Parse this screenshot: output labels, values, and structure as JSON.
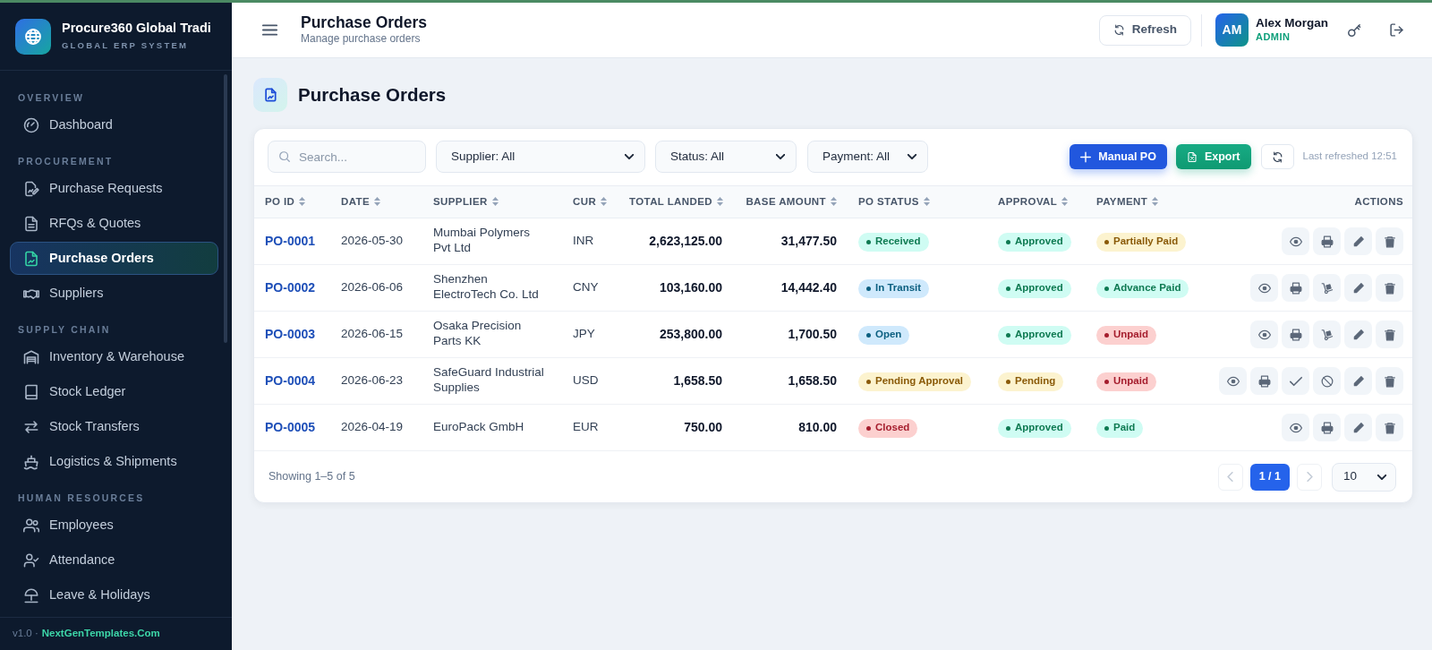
{
  "sidebar": {
    "brand": {
      "title": "Procure360 Global Tradi",
      "subtitle": "GLOBAL ERP SYSTEM"
    },
    "sections": [
      {
        "label": "OVERVIEW",
        "items": [
          {
            "label": "Dashboard",
            "selected": false
          }
        ]
      },
      {
        "label": "PROCUREMENT",
        "items": [
          {
            "label": "Purchase Requests",
            "selected": false
          },
          {
            "label": "RFQs & Quotes",
            "selected": false
          },
          {
            "label": "Purchase Orders",
            "selected": true
          },
          {
            "label": "Suppliers",
            "selected": false
          }
        ]
      },
      {
        "label": "SUPPLY CHAIN",
        "items": [
          {
            "label": "Inventory & Warehouse",
            "selected": false
          },
          {
            "label": "Stock Ledger",
            "selected": false
          },
          {
            "label": "Stock Transfers",
            "selected": false
          },
          {
            "label": "Logistics & Shipments",
            "selected": false
          }
        ]
      },
      {
        "label": "HUMAN RESOURCES",
        "items": [
          {
            "label": "Employees",
            "selected": false
          },
          {
            "label": "Attendance",
            "selected": false
          },
          {
            "label": "Leave & Holidays",
            "selected": false
          }
        ]
      }
    ],
    "footer": {
      "version": "v1.0 ·",
      "link": "NextGenTemplates.Com"
    }
  },
  "header": {
    "title": "Purchase Orders",
    "subtitle": "Manage purchase orders",
    "refresh_button": "Refresh",
    "user": {
      "initials": "AM",
      "name": "Alex Morgan",
      "role": "ADMIN"
    }
  },
  "page": {
    "title": "Purchase Orders"
  },
  "toolbar": {
    "search": {
      "placeholder": "Search..."
    },
    "filters": [
      {
        "value": "Supplier: All"
      },
      {
        "value": "Status: All"
      },
      {
        "value": "Payment: All"
      }
    ],
    "buttons": [
      {
        "label": "Manual PO",
        "kind": "primary"
      },
      {
        "label": "Export",
        "kind": "success"
      }
    ],
    "last_refreshed": "Last refreshed 12:51"
  },
  "table": {
    "columns": [
      {
        "label": "PO ID",
        "sortable": true
      },
      {
        "label": "DATE",
        "sortable": true
      },
      {
        "label": "SUPPLIER",
        "sortable": true
      },
      {
        "label": "CUR",
        "sortable": true
      },
      {
        "label": "TOTAL LANDED",
        "sortable": true
      },
      {
        "label": "BASE AMOUNT",
        "sortable": true
      },
      {
        "label": "PO STATUS",
        "sortable": true
      },
      {
        "label": "APPROVAL",
        "sortable": true
      },
      {
        "label": "PAYMENT",
        "sortable": true
      },
      {
        "label": "ACTIONS",
        "sortable": false
      }
    ],
    "rows": [
      {
        "po_id": "PO-0001",
        "date": "2026-05-30",
        "supplier": "Mumbai Polymers Pvt Ltd",
        "currency": "INR",
        "total_landed": "2,623,125.00",
        "base_amount": "31,477.50",
        "po_status": {
          "text": "Received",
          "color": "#0e7a52"
        },
        "approval": {
          "text": "Approved",
          "color": "#0e7a52"
        },
        "payment": {
          "text": "Partially Paid",
          "color": "#8a5a08"
        },
        "actions": [
          {
            "kind": "view"
          },
          {
            "kind": "print"
          },
          {
            "kind": "edit"
          },
          {
            "kind": "delete"
          }
        ]
      },
      {
        "po_id": "PO-0002",
        "date": "2026-06-06",
        "supplier": "Shenzhen ElectroTech Co. Ltd",
        "currency": "CNY",
        "total_landed": "103,160.00",
        "base_amount": "14,442.40",
        "po_status": {
          "text": "In Transit",
          "color": "#0b5f80"
        },
        "approval": {
          "text": "Approved",
          "color": "#0e7a52"
        },
        "payment": {
          "text": "Advance Paid",
          "color": "#0e7a52"
        },
        "actions": [
          {
            "kind": "view"
          },
          {
            "kind": "print"
          },
          {
            "kind": "receive"
          },
          {
            "kind": "edit"
          },
          {
            "kind": "delete"
          }
        ]
      },
      {
        "po_id": "PO-0003",
        "date": "2026-06-15",
        "supplier": "Osaka Precision Parts KK",
        "currency": "JPY",
        "total_landed": "253,800.00",
        "base_amount": "1,700.50",
        "po_status": {
          "text": "Open",
          "color": "#0b5f80"
        },
        "approval": {
          "text": "Approved",
          "color": "#0e7a52"
        },
        "payment": {
          "text": "Unpaid",
          "color": "#a51d2d"
        },
        "actions": [
          {
            "kind": "view"
          },
          {
            "kind": "print"
          },
          {
            "kind": "receive"
          },
          {
            "kind": "edit"
          },
          {
            "kind": "delete"
          }
        ]
      },
      {
        "po_id": "PO-0004",
        "date": "2026-06-23",
        "supplier": "SafeGuard Industrial Supplies",
        "currency": "USD",
        "total_landed": "1,658.50",
        "base_amount": "1,658.50",
        "po_status": {
          "text": "Pending Approval",
          "color": "#8a5a08"
        },
        "approval": {
          "text": "Pending",
          "color": "#8a5a08"
        },
        "payment": {
          "text": "Unpaid",
          "color": "#a51d2d"
        },
        "actions": [
          {
            "kind": "view"
          },
          {
            "kind": "print"
          },
          {
            "kind": "approve"
          },
          {
            "kind": "reject"
          },
          {
            "kind": "edit"
          },
          {
            "kind": "delete"
          }
        ]
      },
      {
        "po_id": "PO-0005",
        "date": "2026-04-19",
        "supplier": "EuroPack GmbH",
        "currency": "EUR",
        "total_landed": "750.00",
        "base_amount": "810.00",
        "po_status": {
          "text": "Closed",
          "color": "#a51d2d"
        },
        "approval": {
          "text": "Approved",
          "color": "#0e7a52"
        },
        "payment": {
          "text": "Paid",
          "color": "#0e7a52"
        },
        "actions": [
          {
            "kind": "view"
          },
          {
            "kind": "print"
          },
          {
            "kind": "edit"
          },
          {
            "kind": "delete"
          }
        ]
      }
    ]
  },
  "footer": {
    "summary": "Showing 1–5 of 5",
    "prev": {
      "disabled": true
    },
    "page": "1 / 1",
    "next": {
      "disabled": true
    },
    "page_size": "10"
  }
}
